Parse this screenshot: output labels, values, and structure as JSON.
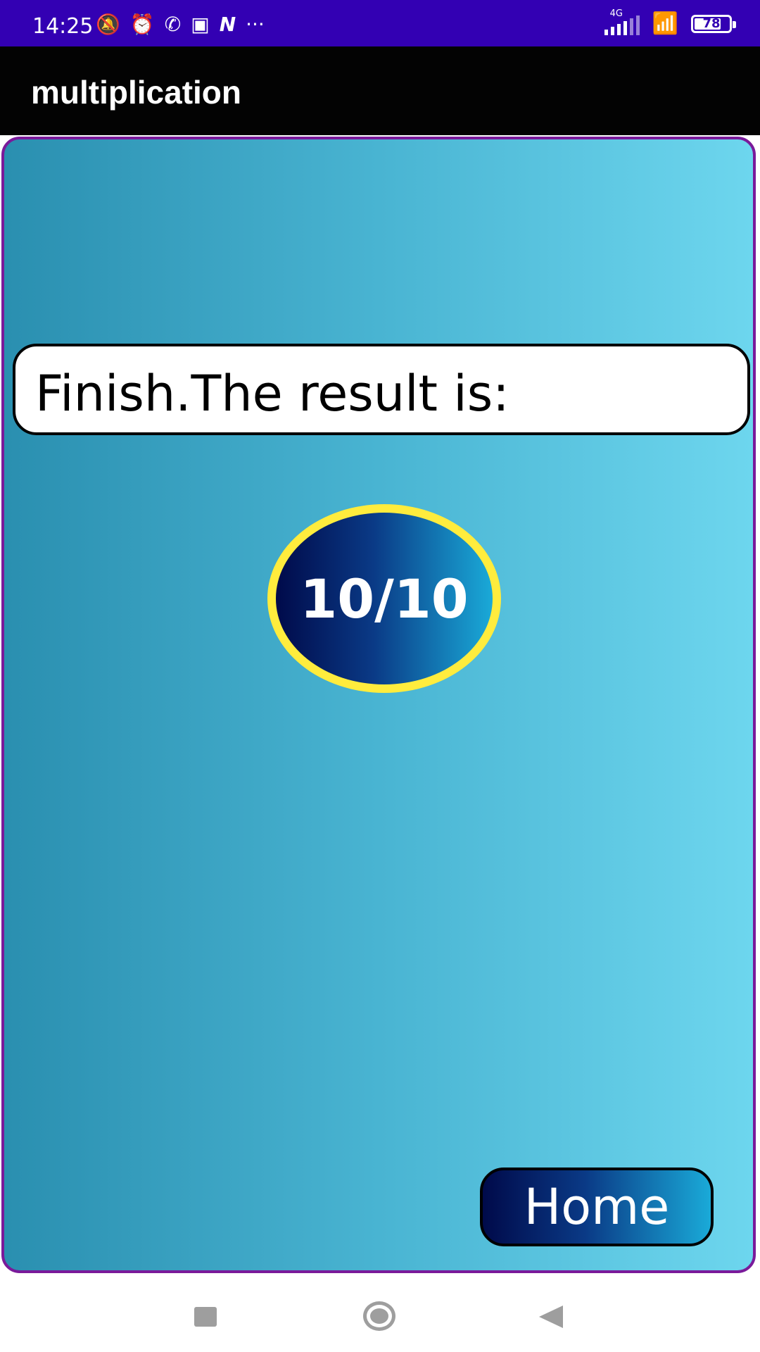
{
  "status_bar": {
    "time": "14:25",
    "left_icons": [
      "bell-off-icon",
      "alarm-icon",
      "whatsapp-icon",
      "app-icon",
      "n-icon",
      "more-dots-icon"
    ],
    "network_label": "4G",
    "battery_level": "78",
    "battery_fraction": 0.78
  },
  "app_bar": {
    "title": "multiplication"
  },
  "main": {
    "message": "Finish.The result is:",
    "score": "10/10",
    "home_label": "Home"
  },
  "colors": {
    "status_bar": "#3300b3",
    "app_bar": "#030303",
    "panel_border": "#7a1a9a",
    "panel_gradient_start": "#2a8fb0",
    "panel_gradient_end": "#6dd6ee",
    "oval_border": "#ffec3d",
    "button_gradient_start": "#000a4a",
    "button_gradient_end": "#1aaad8"
  }
}
